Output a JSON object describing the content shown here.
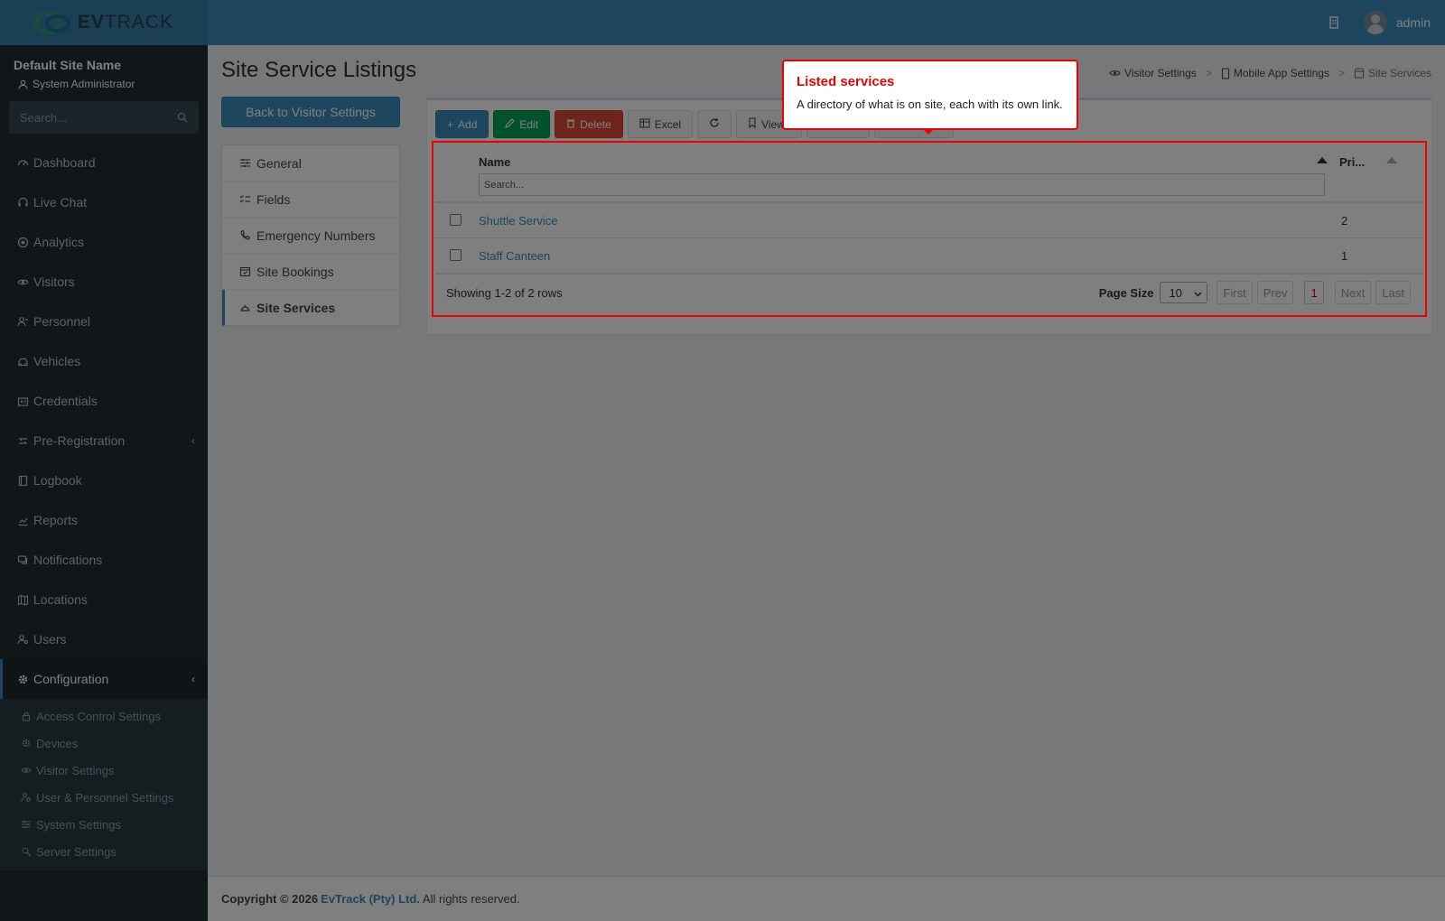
{
  "brand": {
    "logo_text_bold": "EV",
    "logo_text_rest": "TRACK"
  },
  "header": {
    "username": "admin"
  },
  "sidebar": {
    "site_name": "Default Site Name",
    "role": "System Administrator",
    "search_placeholder": "Search...",
    "items": [
      {
        "label": "Dashboard",
        "icon": "dashboard-icon"
      },
      {
        "label": "Live Chat",
        "icon": "headset-icon"
      },
      {
        "label": "Analytics",
        "icon": "target-icon"
      },
      {
        "label": "Visitors",
        "icon": "eye-icon"
      },
      {
        "label": "Personnel",
        "icon": "person-icon"
      },
      {
        "label": "Vehicles",
        "icon": "car-icon"
      },
      {
        "label": "Credentials",
        "icon": "id-card-icon"
      },
      {
        "label": "Pre-Registration",
        "icon": "arrows-icon"
      },
      {
        "label": "Logbook",
        "icon": "book-icon"
      },
      {
        "label": "Reports",
        "icon": "report-icon"
      },
      {
        "label": "Notifications",
        "icon": "chat-icon"
      },
      {
        "label": "Locations",
        "icon": "map-icon"
      },
      {
        "label": "Users",
        "icon": "users-icon"
      },
      {
        "label": "Configuration",
        "icon": "gear-icon"
      }
    ],
    "sub_items": [
      {
        "label": "Access Control Settings",
        "icon": "lock-icon"
      },
      {
        "label": "Devices",
        "icon": "cog-icon"
      },
      {
        "label": "Visitor Settings",
        "icon": "eye-icon"
      },
      {
        "label": "User & Personnel Settings",
        "icon": "user-cog-icon"
      },
      {
        "label": "System Settings",
        "icon": "sliders-icon"
      },
      {
        "label": "Server Settings",
        "icon": "server-icon"
      }
    ]
  },
  "page": {
    "title": "Site Service Listings",
    "breadcrumb": [
      "Visitor Settings",
      "Mobile App Settings",
      "Site Services"
    ],
    "back_button": "Back to Visitor Settings",
    "subnav": [
      "General",
      "Fields",
      "Emergency Numbers",
      "Site Bookings",
      "Site Services"
    ]
  },
  "toolbar": {
    "add": "Add",
    "edit": "Edit",
    "delete": "Delete",
    "excel": "Excel",
    "views": "Views"
  },
  "table": {
    "headers": {
      "name": "Name",
      "priority": "Pri..."
    },
    "search_placeholder": "Search...",
    "rows": [
      {
        "name": "Shuttle Service",
        "priority": "2"
      },
      {
        "name": "Staff Canteen",
        "priority": "1"
      }
    ],
    "showing": "Showing 1-2 of 2 rows",
    "page_size_label": "Page Size",
    "page_size": "10",
    "pager": {
      "first": "First",
      "prev": "Prev",
      "current": "1",
      "next": "Next",
      "last": "Last"
    }
  },
  "footer": {
    "prefix": "Copyright © 2026",
    "company": "EvTrack (Pty) Ltd.",
    "suffix": "All rights reserved."
  },
  "tooltip": {
    "title": "Listed services",
    "body": "A directory of what is on site, each with its own link."
  },
  "colors": {
    "primary": "#3c8dbc",
    "success": "#00a65a",
    "danger": "#dd4b39",
    "sidebar": "#222d32",
    "highlight": "#ee0000"
  }
}
